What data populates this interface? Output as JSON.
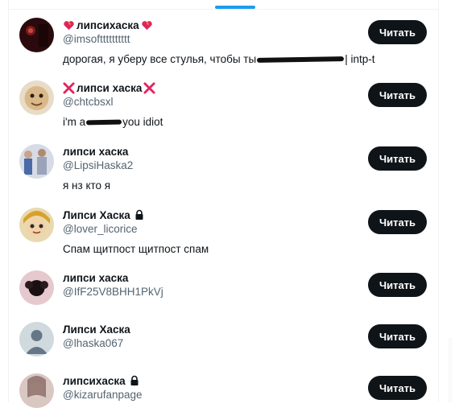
{
  "users": [
    {
      "name": "липсихаска",
      "handle": "@imsoftttttttttt",
      "bio_before": "дорогая, я уберу все стулья, чтобы ты",
      "bio_after": " | intp-t",
      "button": "Читать"
    },
    {
      "name": "липси хаска",
      "handle": "@chtcbsxl",
      "bio_before": "i'm a",
      "bio_after": "you idiot",
      "button": "Читать"
    },
    {
      "name": "липси хаска",
      "handle": "@LipsiHaska2",
      "bio": "я нз кто я",
      "button": "Читать"
    },
    {
      "name": "Липси Хаска",
      "handle": "@lover_licorice",
      "bio": "Спам щитпост щитпост спам",
      "button": "Читать"
    },
    {
      "name": "липси хаска",
      "handle": "@IfF25V8BHH1PkVj",
      "button": "Читать"
    },
    {
      "name": "Липси Хаска",
      "handle": "@lhaska067",
      "button": "Читать"
    },
    {
      "name": "липсихаска",
      "handle": "@kizarufanpage",
      "button": "Читать"
    }
  ],
  "icons": {
    "heart_fire": "heart-on-fire-icon",
    "cross_mark": "cross-mark-icon",
    "lock": "lock-icon"
  },
  "colors": {
    "accent": "#1d9bf0",
    "button_bg": "#0f1419",
    "secondary_text": "#536471"
  }
}
